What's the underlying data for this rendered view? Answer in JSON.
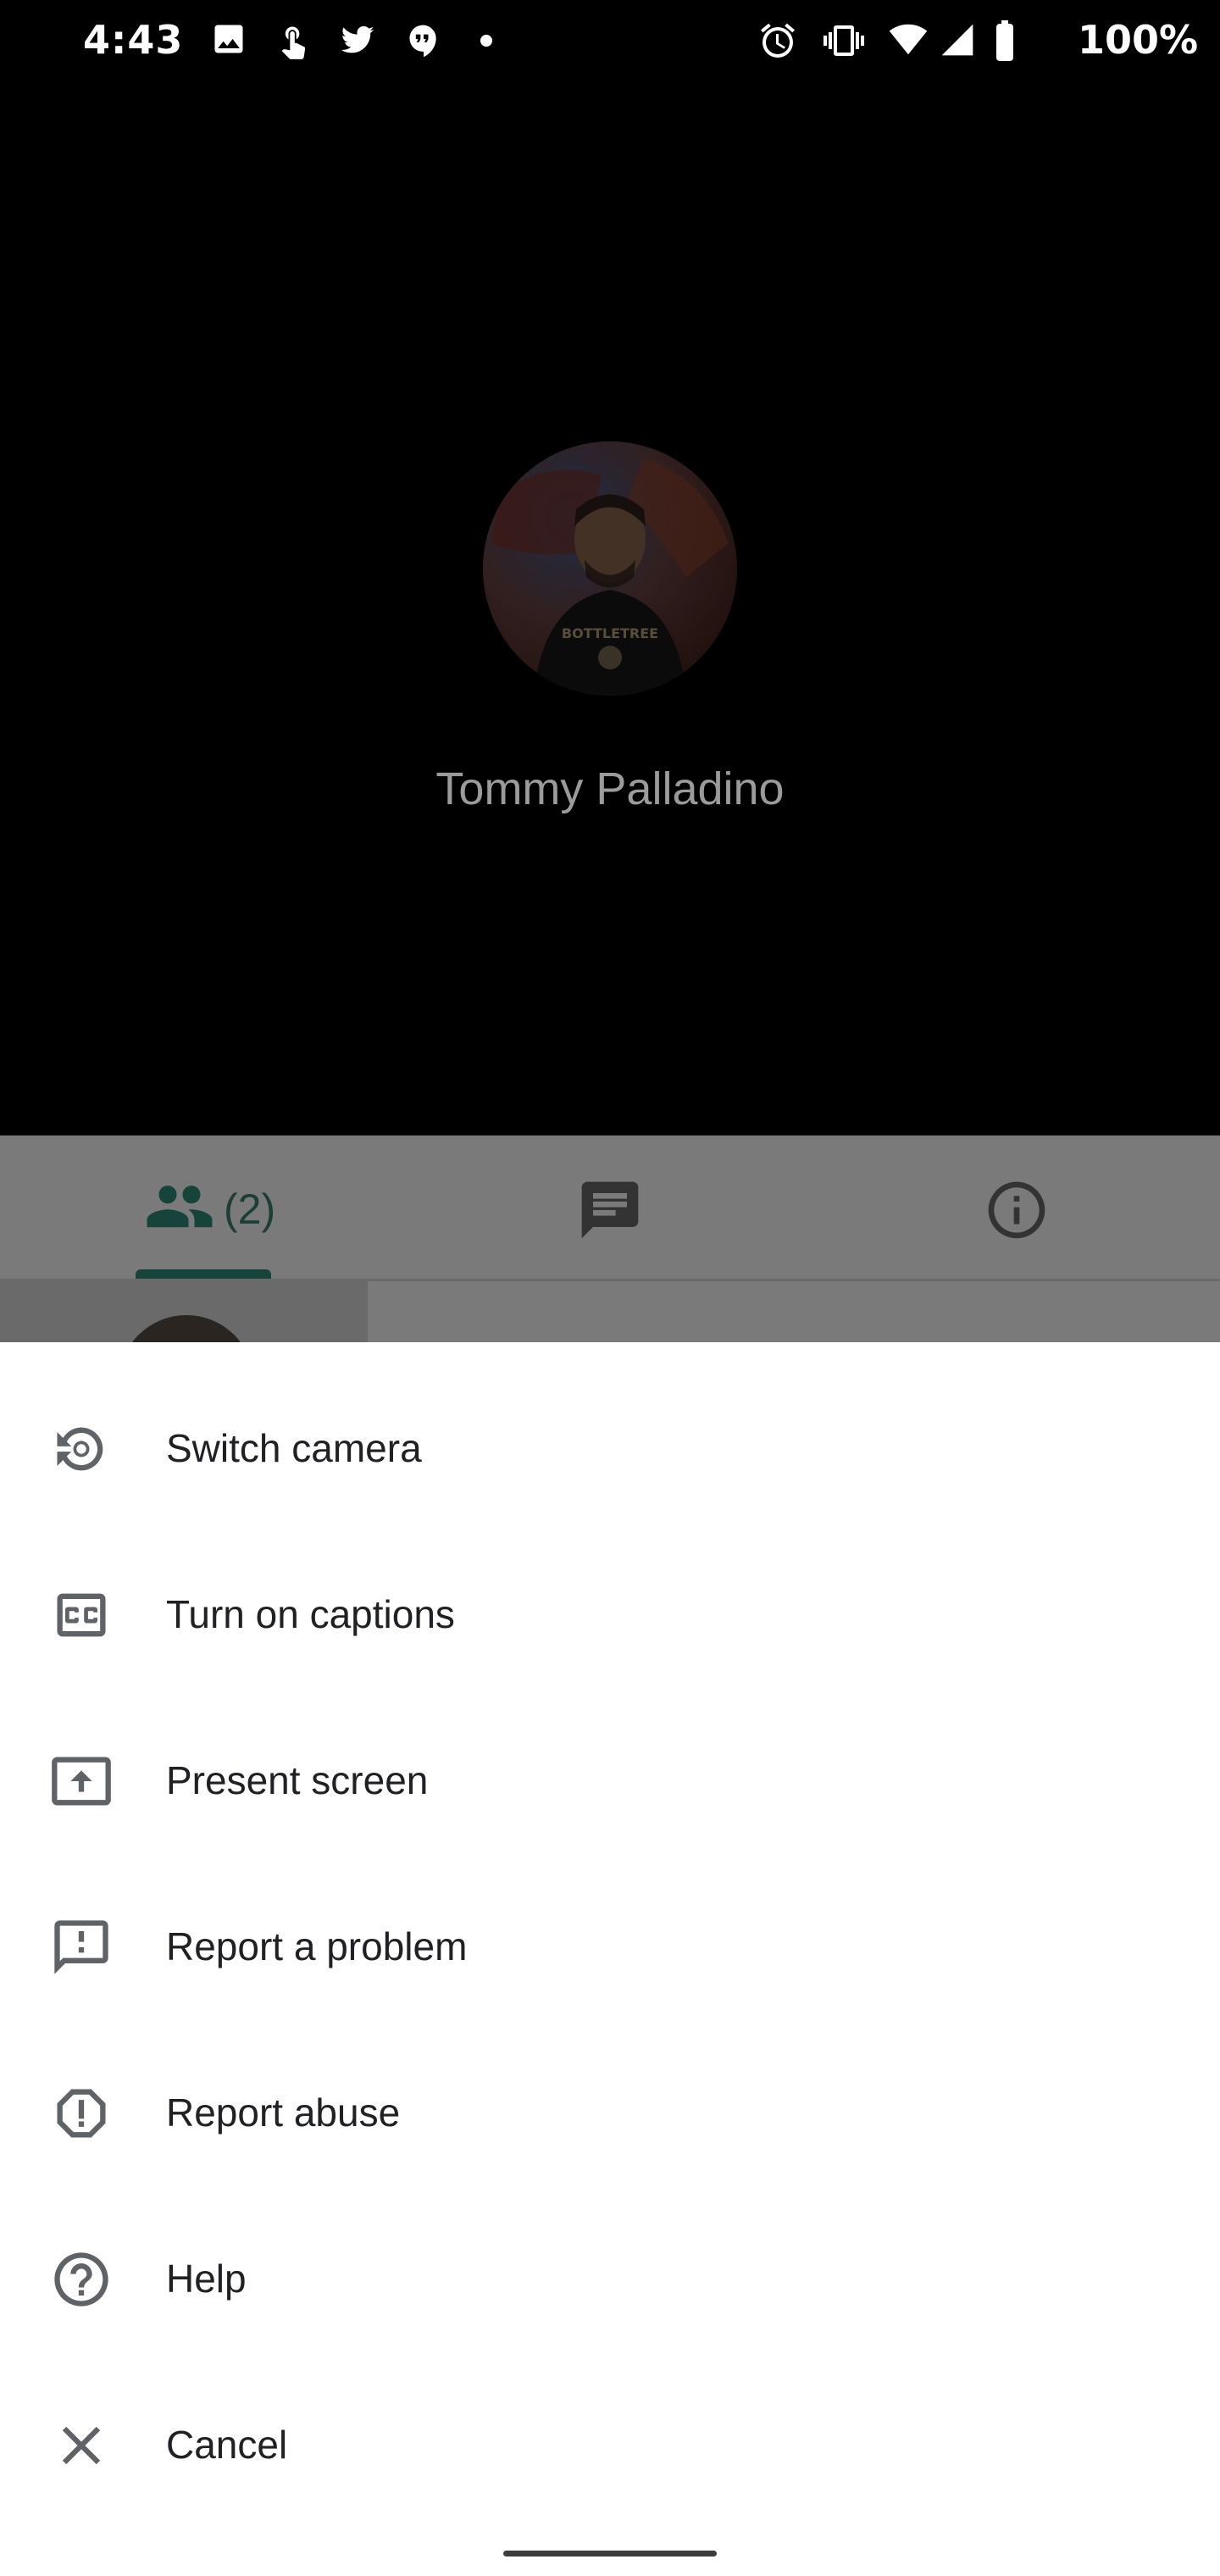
{
  "status_bar": {
    "time": "4:43",
    "battery": "100%",
    "left_icons": [
      "image-icon",
      "touch-icon",
      "twitter-icon",
      "hangouts-icon",
      "dot-icon"
    ],
    "right_icons": [
      "alarm-icon",
      "vibrate-icon",
      "wifi-icon",
      "signal-icon",
      "battery-icon"
    ]
  },
  "call": {
    "caller_name": "Tommy Palladino"
  },
  "tabs": {
    "people_count": "(2)",
    "items": [
      "people-icon",
      "chat-icon",
      "info-icon"
    ]
  },
  "menu": {
    "items": [
      {
        "label": "Switch camera",
        "icon": "switch-camera-icon"
      },
      {
        "label": "Turn on captions",
        "icon": "captions-icon"
      },
      {
        "label": "Present screen",
        "icon": "present-screen-icon"
      },
      {
        "label": "Report a problem",
        "icon": "report-problem-icon"
      },
      {
        "label": "Report abuse",
        "icon": "report-abuse-icon"
      },
      {
        "label": "Help",
        "icon": "help-icon"
      },
      {
        "label": "Cancel",
        "icon": "close-icon"
      }
    ]
  },
  "colors": {
    "sheet_background": "#ffffff",
    "text": "#202124",
    "icon": "#5f6368",
    "accent_dimmed": "#16443b"
  }
}
